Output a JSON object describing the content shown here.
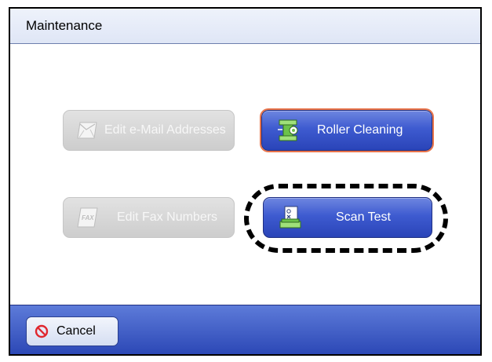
{
  "window": {
    "title": "Maintenance"
  },
  "buttons": {
    "edit_email": {
      "label": "Edit e-Mail Addresses",
      "icon": "mail-icon",
      "enabled": false
    },
    "roller_cleaning": {
      "label": "Roller Cleaning",
      "icon": "roller-icon",
      "enabled": true
    },
    "edit_fax": {
      "label": "Edit Fax Numbers",
      "icon": "fax-icon",
      "enabled": false
    },
    "scan_test": {
      "label": "Scan Test",
      "icon": "scan-test-icon",
      "enabled": true,
      "highlighted": true
    }
  },
  "footer": {
    "cancel_label": "Cancel",
    "cancel_icon": "prohibit-icon"
  },
  "colors": {
    "active_button": "#3e5bd0",
    "disabled_button": "#d6d6d6",
    "focus_outline": "#e9744a",
    "footer": "#2c48b6"
  }
}
